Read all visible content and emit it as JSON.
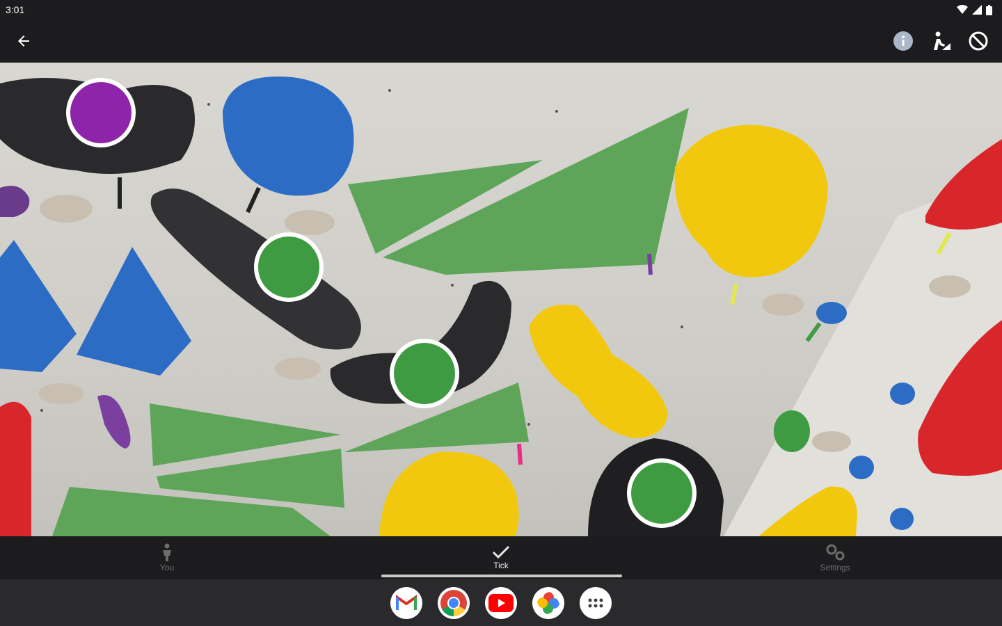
{
  "status_bar": {
    "time": "3:01"
  },
  "app_bar": {
    "icons": [
      "back-arrow-icon",
      "info-icon",
      "set-route-icon",
      "block-icon"
    ]
  },
  "holds": {
    "colors": {
      "purple": "#8e24aa",
      "green": "#3f9b41",
      "wall_green": "#5ea55a",
      "black": "#2a2a2c",
      "blue": "#2d6cc4",
      "yellow": "#f2c80f",
      "red": "#d9262b"
    }
  },
  "bottom_nav": {
    "items": [
      {
        "label": "You",
        "icon": "person-icon",
        "active": false
      },
      {
        "label": "Tick",
        "icon": "check-icon",
        "active": true
      },
      {
        "label": "Settings",
        "icon": "gears-icon",
        "active": false
      }
    ]
  },
  "taskbar": {
    "apps": [
      "gmail-icon",
      "chrome-icon",
      "youtube-icon",
      "photos-icon",
      "app-drawer-icon"
    ]
  }
}
